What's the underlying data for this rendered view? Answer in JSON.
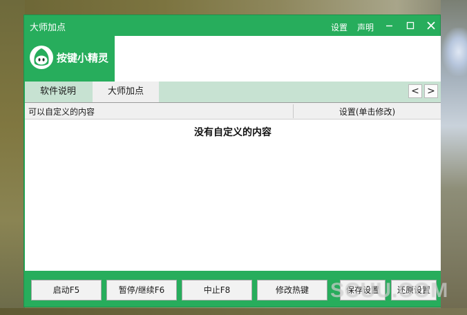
{
  "window": {
    "title": "大师加点",
    "links": {
      "settings": "设置",
      "statement": "声明"
    }
  },
  "logo": {
    "text": "按键小精灵",
    "icon": "elf-logo-icon"
  },
  "tabs": [
    {
      "label": "软件说明",
      "active": false
    },
    {
      "label": "大师加点",
      "active": true
    }
  ],
  "tab_nav": {
    "prev": "<",
    "next": ">"
  },
  "table": {
    "columns": [
      "可以自定义的内容",
      "设置(单击修改)"
    ],
    "empty_message": "没有自定义的内容"
  },
  "buttons": {
    "start": "启动F5",
    "pause": "暂停/继续F6",
    "stop": "中止F8",
    "hotkey": "修改热键",
    "save": "保存设置",
    "restore": "还原设置"
  },
  "watermark": "SCUU.COM",
  "colors": {
    "accent": "#27ad5c",
    "tab_bar": "#c7e2d2",
    "active_tab": "#efefef"
  }
}
